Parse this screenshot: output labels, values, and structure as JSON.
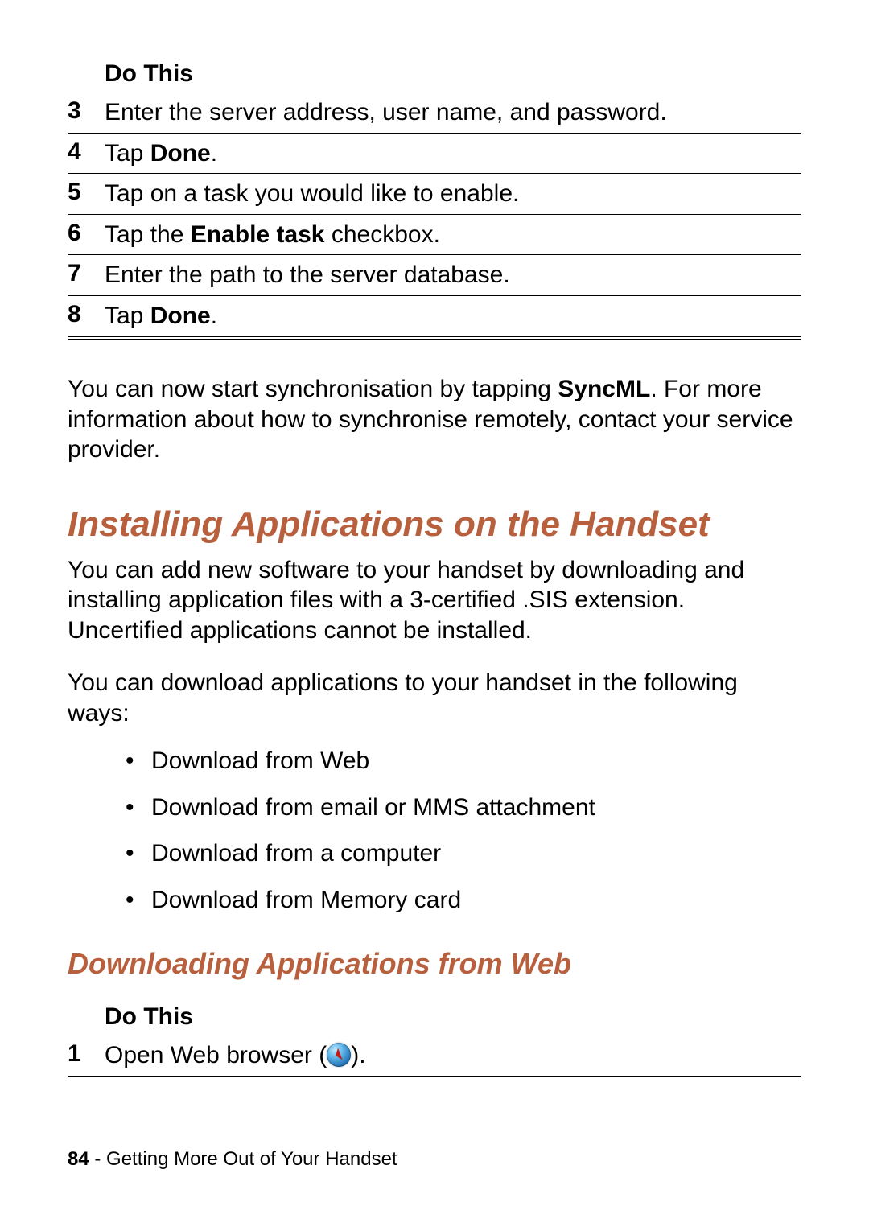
{
  "colors": {
    "accent": "#b8603d"
  },
  "table1": {
    "header": "Do This",
    "rows": [
      {
        "num": "3",
        "pre": "Enter the server address, user name, and password.",
        "strong": "",
        "post": ""
      },
      {
        "num": "4",
        "pre": "Tap ",
        "strong": "Done",
        "post": "."
      },
      {
        "num": "5",
        "pre": "Tap on a task you would like to enable.",
        "strong": "",
        "post": ""
      },
      {
        "num": "6",
        "pre": "Tap the ",
        "strong": "Enable task",
        "post": " checkbox."
      },
      {
        "num": "7",
        "pre": "Enter the path to the server database.",
        "strong": "",
        "post": ""
      },
      {
        "num": "8",
        "pre": "Tap ",
        "strong": "Done",
        "post": "."
      }
    ]
  },
  "para_sync": {
    "pre": "You can now start synchronisation by tapping ",
    "strong": "SyncML",
    "post": ". For more information about how to synchronise remotely, contact your service provider."
  },
  "heading1": "Installing Applications on the Handset",
  "para_install": "You can add new software to your handset by downloading and installing application files with a 3-certified .SIS extension. Uncertified applications cannot be installed.",
  "para_ways": "You can download applications to your handset in the following ways:",
  "bullets": [
    "Download from Web",
    "Download from email or MMS attachment",
    "Download from a computer",
    "Download from Memory card"
  ],
  "heading2": "Downloading Applications from Web",
  "table2": {
    "header": "Do This",
    "rows": [
      {
        "num": "1",
        "pre": "Open Web browser (",
        "icon": "web-browser-icon",
        "post": ")."
      }
    ]
  },
  "footer": {
    "page": "84",
    "sep": " - ",
    "title": "Getting More Out of Your Handset"
  }
}
